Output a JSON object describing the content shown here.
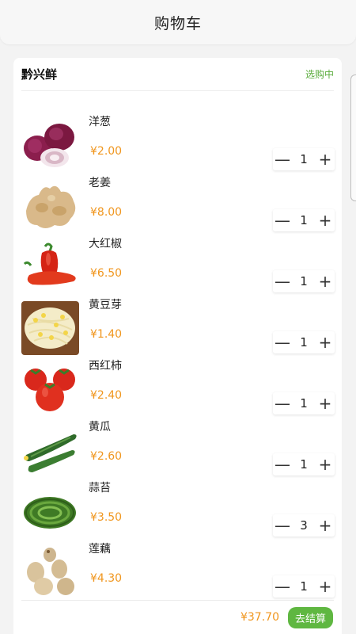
{
  "header": {
    "title": "购物车"
  },
  "store": {
    "name": "黔兴鲜",
    "status": "选购中"
  },
  "items": [
    {
      "name": "洋葱",
      "price": "¥2.00",
      "qty": "1",
      "icon": "onion-image"
    },
    {
      "name": "老姜",
      "price": "¥8.00",
      "qty": "1",
      "icon": "ginger-image"
    },
    {
      "name": "大红椒",
      "price": "¥6.50",
      "qty": "1",
      "icon": "red-pepper-image"
    },
    {
      "name": "黄豆芽",
      "price": "¥1.40",
      "qty": "1",
      "icon": "soybean-sprouts-image"
    },
    {
      "name": "西红柿",
      "price": "¥2.40",
      "qty": "1",
      "icon": "tomato-image"
    },
    {
      "name": "黄瓜",
      "price": "¥2.60",
      "qty": "1",
      "icon": "cucumber-image"
    },
    {
      "name": "蒜苔",
      "price": "¥3.50",
      "qty": "3",
      "icon": "garlic-sprouts-image"
    },
    {
      "name": "莲藕",
      "price": "¥4.30",
      "qty": "1",
      "icon": "lotus-root-image"
    }
  ],
  "stepper": {
    "minus": "—",
    "plus": "+"
  },
  "footer": {
    "total": "¥37.70",
    "checkout_label": "去结算"
  },
  "colors": {
    "accent_green": "#5fb741",
    "price_orange": "#f0961e",
    "status_green": "#5aac3c"
  }
}
